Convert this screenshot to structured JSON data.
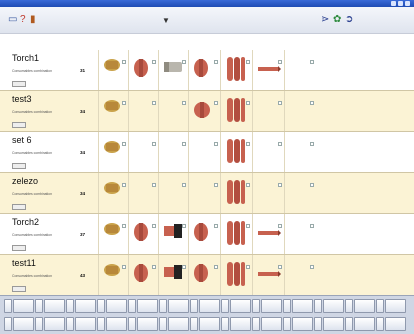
{
  "window": {},
  "toolbar": {},
  "rows": [
    {
      "name": "Torch1",
      "combination_label": "Consumables combination",
      "count": "31",
      "shade": "plain"
    },
    {
      "name": "test3",
      "combination_label": "Consumables combination",
      "count": "34",
      "shade": "alt"
    },
    {
      "name": "set 6",
      "combination_label": "Consumables combination",
      "count": "34",
      "shade": "plain"
    },
    {
      "name": "zelezo",
      "combination_label": "Consumables combination",
      "count": "34",
      "shade": "alt"
    },
    {
      "name": "Torch2",
      "combination_label": "Consumables combination",
      "count": "37",
      "shade": "plain"
    },
    {
      "name": "test11",
      "combination_label": "Consumables combination",
      "count": "43",
      "shade": "alt"
    }
  ],
  "colors": {
    "row_alt": "#fbf3d5",
    "toolbar": "#dfe4ee",
    "titlebar": "#1f4cb4",
    "copper": "#c7614f",
    "brass": "#c9a24a"
  }
}
